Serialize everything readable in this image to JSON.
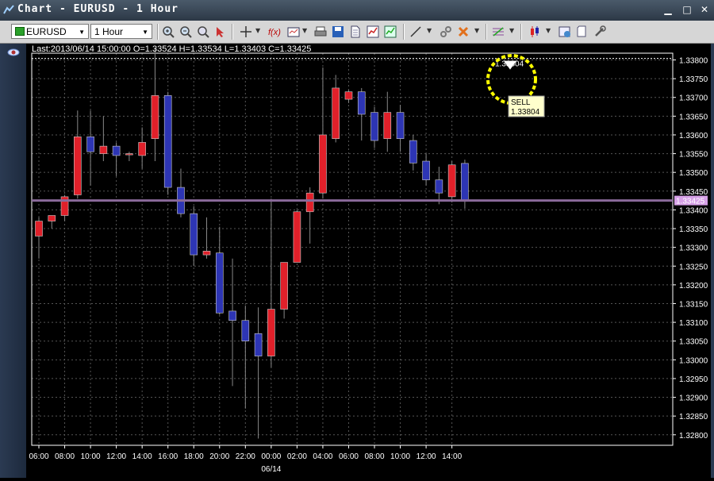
{
  "window": {
    "title": "Chart - EURUSD - 1 Hour"
  },
  "toolbar": {
    "symbol": "EURUSD",
    "timeframe": "1 Hour"
  },
  "info_line": "Last:2013/06/14 15:00:00 O=1.33524 H=1.33534 L=1.33403 C=1.33425",
  "order": {
    "side": "SELL",
    "price": "1.33804",
    "tag_price": "1.33804"
  },
  "current_price": "1.33425",
  "colors": {
    "up": "#e0202a",
    "down": "#2d35b4",
    "grid": "#555555",
    "current_line": "#8a6a9a",
    "highlight": "#ffff00"
  },
  "chart_data": {
    "type": "candlestick",
    "y_ticks": [
      "1.33800",
      "1.33750",
      "1.33700",
      "1.33650",
      "1.33600",
      "1.33550",
      "1.33500",
      "1.33450",
      "1.33400",
      "1.33350",
      "1.33300",
      "1.33250",
      "1.33200",
      "1.33150",
      "1.33100",
      "1.33050",
      "1.33000",
      "1.32950",
      "1.32900",
      "1.32850",
      "1.32800"
    ],
    "ylim": [
      1.3278,
      1.3383
    ],
    "x_labels": [
      "06:00",
      "08:00",
      "10:00",
      "12:00",
      "14:00",
      "16:00",
      "18:00",
      "20:00",
      "22:00",
      "00:00",
      "02:00",
      "04:00",
      "06:00",
      "08:00",
      "10:00",
      "12:00",
      "14:00"
    ],
    "date_label": "06/14",
    "candles": [
      {
        "o": 1.3333,
        "h": 1.3338,
        "l": 1.3327,
        "c": 1.3337
      },
      {
        "o": 1.3337,
        "h": 1.3338,
        "l": 1.3335,
        "c": 1.33385
      },
      {
        "o": 1.33385,
        "h": 1.3344,
        "l": 1.3337,
        "c": 1.33435
      },
      {
        "o": 1.3344,
        "h": 1.33665,
        "l": 1.3343,
        "c": 1.33595
      },
      {
        "o": 1.33595,
        "h": 1.33665,
        "l": 1.33465,
        "c": 1.33555
      },
      {
        "o": 1.3355,
        "h": 1.3365,
        "l": 1.3353,
        "c": 1.3357
      },
      {
        "o": 1.3357,
        "h": 1.3358,
        "l": 1.3349,
        "c": 1.33545
      },
      {
        "o": 1.3355,
        "h": 1.33555,
        "l": 1.3353,
        "c": 1.3355
      },
      {
        "o": 1.33545,
        "h": 1.3362,
        "l": 1.3351,
        "c": 1.3358
      },
      {
        "o": 1.3359,
        "h": 1.3383,
        "l": 1.3353,
        "c": 1.33705
      },
      {
        "o": 1.33705,
        "h": 1.33715,
        "l": 1.3344,
        "c": 1.3346
      },
      {
        "o": 1.3346,
        "h": 1.3351,
        "l": 1.3338,
        "c": 1.3339
      },
      {
        "o": 1.3339,
        "h": 1.3341,
        "l": 1.3325,
        "c": 1.3328
      },
      {
        "o": 1.3328,
        "h": 1.3338,
        "l": 1.3327,
        "c": 1.3329
      },
      {
        "o": 1.33285,
        "h": 1.33355,
        "l": 1.3312,
        "c": 1.33125
      },
      {
        "o": 1.3313,
        "h": 1.3327,
        "l": 1.3293,
        "c": 1.33105
      },
      {
        "o": 1.33105,
        "h": 1.33145,
        "l": 1.3287,
        "c": 1.3305
      },
      {
        "o": 1.3307,
        "h": 1.3314,
        "l": 1.3279,
        "c": 1.3301
      },
      {
        "o": 1.3301,
        "h": 1.3343,
        "l": 1.3298,
        "c": 1.33135
      },
      {
        "o": 1.33135,
        "h": 1.3326,
        "l": 1.3311,
        "c": 1.3326
      },
      {
        "o": 1.3326,
        "h": 1.334,
        "l": 1.3326,
        "c": 1.33395
      },
      {
        "o": 1.33395,
        "h": 1.3346,
        "l": 1.3331,
        "c": 1.33445
      },
      {
        "o": 1.33445,
        "h": 1.3378,
        "l": 1.3343,
        "c": 1.336
      },
      {
        "o": 1.3359,
        "h": 1.3376,
        "l": 1.3358,
        "c": 1.33725
      },
      {
        "o": 1.33695,
        "h": 1.3372,
        "l": 1.33685,
        "c": 1.33715
      },
      {
        "o": 1.33715,
        "h": 1.33725,
        "l": 1.33585,
        "c": 1.33655
      },
      {
        "o": 1.3366,
        "h": 1.33675,
        "l": 1.33565,
        "c": 1.33585
      },
      {
        "o": 1.3359,
        "h": 1.33715,
        "l": 1.33555,
        "c": 1.3366
      },
      {
        "o": 1.3366,
        "h": 1.3368,
        "l": 1.33555,
        "c": 1.3359
      },
      {
        "o": 1.33585,
        "h": 1.336,
        "l": 1.33505,
        "c": 1.33525
      },
      {
        "o": 1.3353,
        "h": 1.3355,
        "l": 1.33465,
        "c": 1.3348
      },
      {
        "o": 1.3348,
        "h": 1.33515,
        "l": 1.33415,
        "c": 1.33445
      },
      {
        "o": 1.33435,
        "h": 1.3353,
        "l": 1.3342,
        "c": 1.3352
      },
      {
        "o": 1.33524,
        "h": 1.33534,
        "l": 1.33403,
        "c": 1.33425
      }
    ]
  }
}
